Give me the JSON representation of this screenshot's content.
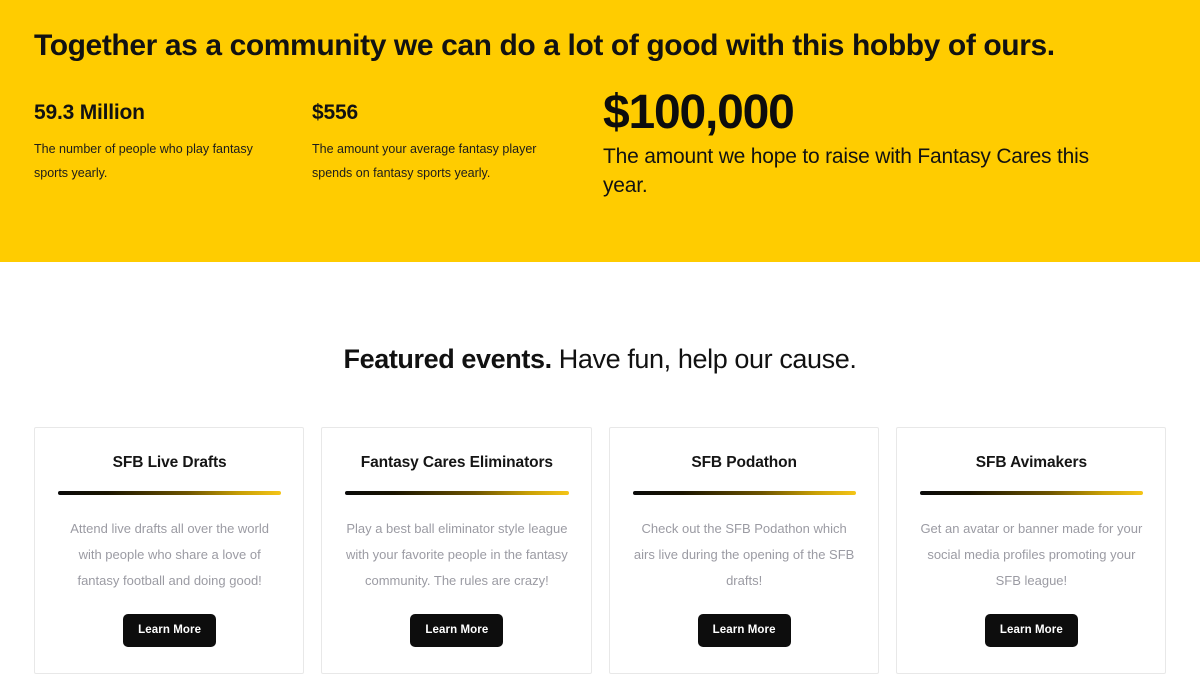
{
  "hero": {
    "title": "Together as a community we can do a lot of good with this hobby of ours.",
    "background_color": "#FFCC00",
    "stats": [
      {
        "value": "59.3 Million",
        "description": "The number of people who play fantasy sports yearly."
      },
      {
        "value": "$556",
        "description": "The amount your average fantasy player spends on fantasy sports yearly."
      }
    ],
    "highlight": {
      "value": "$100,000",
      "description": "The amount we hope to raise with Fantasy Cares this year."
    }
  },
  "featured": {
    "heading_strong": "Featured events.",
    "heading_rest": " Have fun, help our cause.",
    "accent_color": "#F5C518",
    "cards": [
      {
        "title": "SFB Live Drafts",
        "description": "Attend live drafts all over the world with people who share a love of fantasy football and doing good!",
        "button_label": "Learn More"
      },
      {
        "title": "Fantasy Cares Eliminators",
        "description": "Play a best ball eliminator style league with your favorite people in the fantasy community. The rules are crazy!",
        "button_label": "Learn More"
      },
      {
        "title": "SFB Podathon",
        "description": "Check out the SFB Podathon which airs live during the opening of the SFB drafts!",
        "button_label": "Learn More"
      },
      {
        "title": "SFB Avimakers",
        "description": "Get an avatar or banner made for your social media profiles promoting your SFB league!",
        "button_label": "Learn More"
      }
    ]
  }
}
